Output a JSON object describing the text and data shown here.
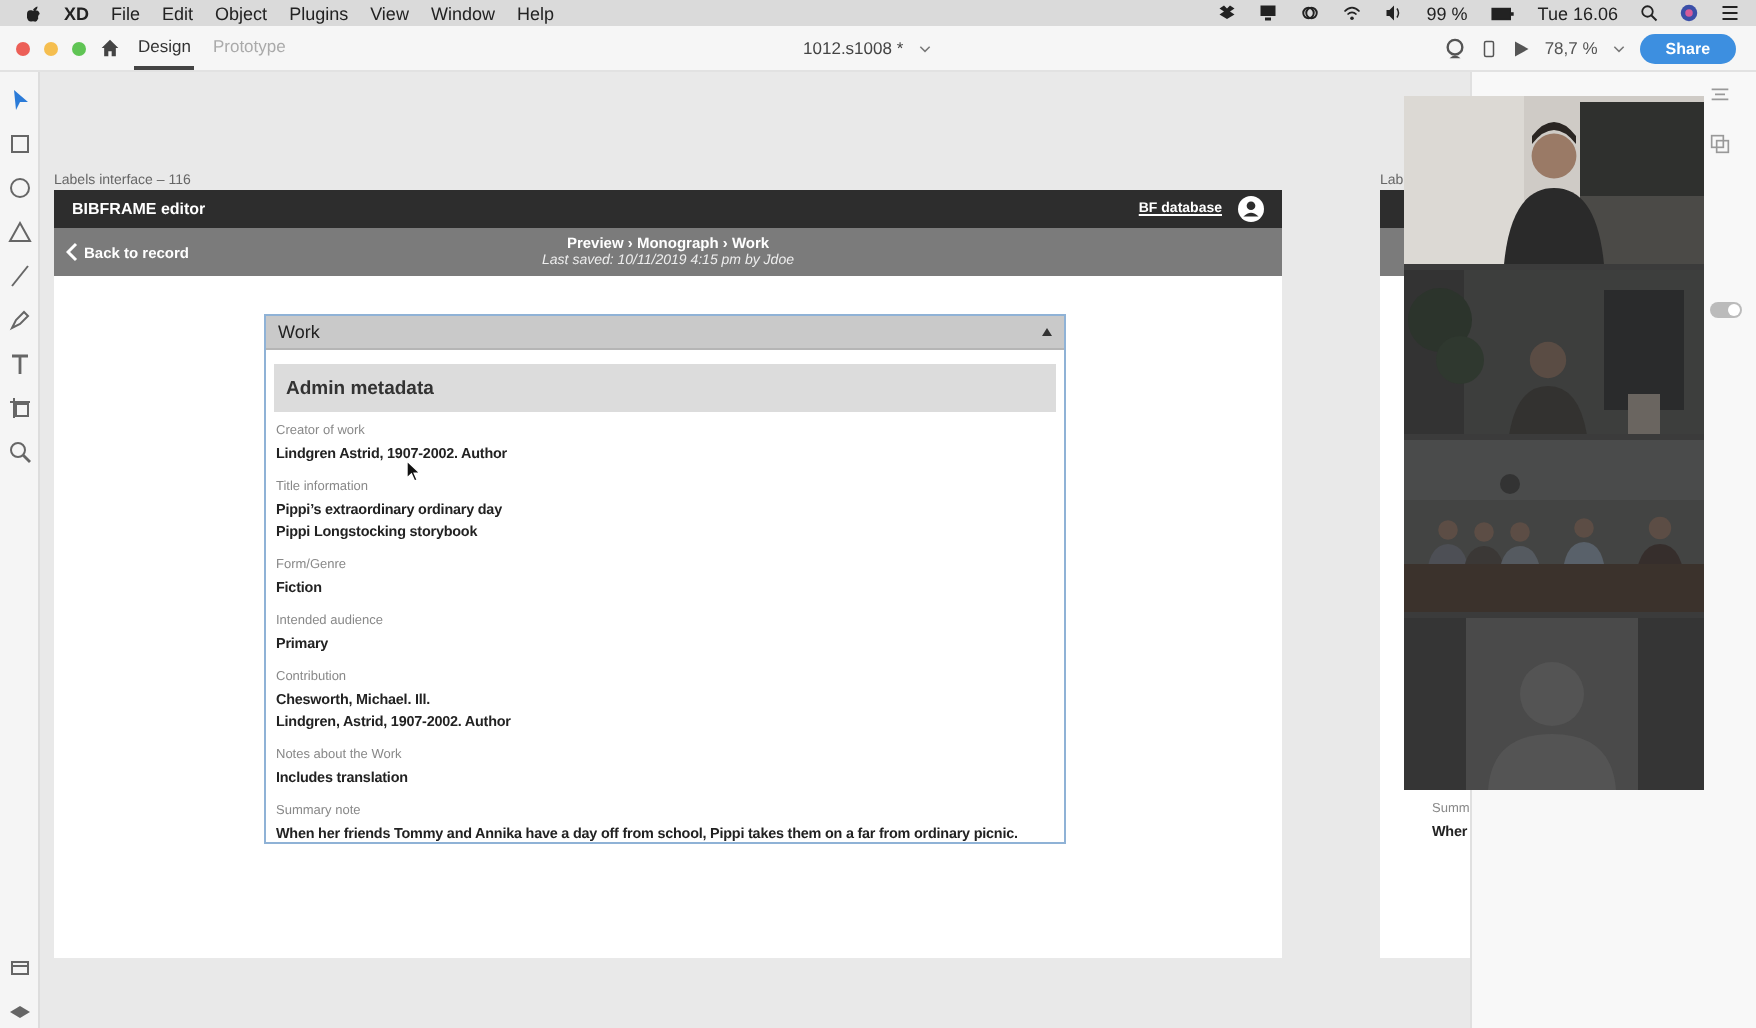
{
  "menu_bar": {
    "app": "XD",
    "items": [
      "File",
      "Edit",
      "Object",
      "Plugins",
      "View",
      "Window",
      "Help"
    ],
    "battery": "99 %",
    "clock": "Tue 16.06"
  },
  "toolbar": {
    "tabs": [
      {
        "label": "Design",
        "selected": true
      },
      {
        "label": "Prototype",
        "selected": false
      }
    ],
    "document_title": "1012.s1008 *",
    "zoom": "78,7 %",
    "share_button": "Share"
  },
  "artboard": {
    "label": "Labels interface – 116",
    "app_title": "BIBFRAME editor",
    "database_link": "BF database",
    "back_link": "Back to record",
    "breadcrumb": "Preview › Monograph › Work",
    "last_saved": "Last saved: 10/11/2019 4:15 pm by Jdoe",
    "panel": {
      "title": "Work",
      "expanded": true,
      "section": "Admin metadata",
      "fields": [
        {
          "label": "Creator of work",
          "values": [
            "Lindgren Astrid, 1907-2002. Author"
          ]
        },
        {
          "label": "Title information",
          "values": [
            "Pippi’s extraordinary ordinary day",
            "Pippi Longstocking storybook"
          ]
        },
        {
          "label": "Form/Genre",
          "values": [
            "Fiction"
          ]
        },
        {
          "label": "Intended audience",
          "values": [
            "Primary"
          ]
        },
        {
          "label": "Contribution",
          "values": [
            "Chesworth, Michael. Ill.",
            "Lindgren, Astrid, 1907-2002. Author"
          ]
        },
        {
          "label": "Notes about the Work",
          "values": [
            "Includes translation"
          ]
        },
        {
          "label": "Summary note",
          "values": [
            "When her friends Tommy and Annika have a day off from school, Pippi takes them on a far from ordinary picnic."
          ]
        }
      ]
    }
  },
  "partial_artboard": {
    "label": "Lab",
    "field_label": "Summ",
    "field_value": "Wher"
  },
  "right_panel": {
    "toggle": {
      "on": true
    }
  }
}
